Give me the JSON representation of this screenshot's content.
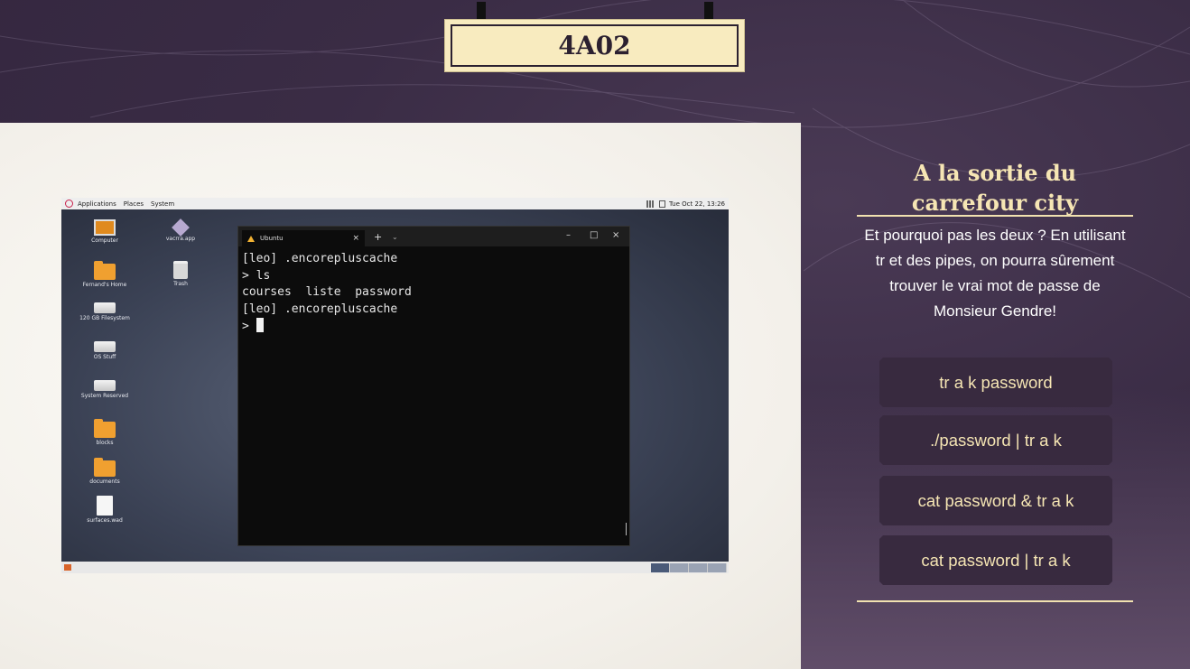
{
  "slide": {
    "title": "4A02",
    "heading": "A la sortie du carrefour city",
    "question": "Et pourquoi pas les deux ? En utilisant tr et des pipes, on pourra sûrement trouver le vrai mot de passe de Monsieur Gendre!",
    "answers": [
      "tr a k password",
      "./password | tr a k",
      "cat password & tr a k",
      "cat password | tr a k"
    ]
  },
  "desktop": {
    "top_bar": {
      "menus": [
        "Applications",
        "Places",
        "System"
      ],
      "clock": "Tue Oct 22, 13:26"
    },
    "icons": [
      {
        "label": "Computer",
        "icon": "computer-icon"
      },
      {
        "label": "vacrra.app",
        "icon": "app-icon"
      },
      {
        "label": "Fernand's Home",
        "icon": "home-folder-icon"
      },
      {
        "label": "Trash",
        "icon": "trash-icon"
      },
      {
        "label": "120 GB Filesystem",
        "icon": "drive-icon"
      },
      {
        "label": "OS Stuff",
        "icon": "drive-icon"
      },
      {
        "label": "System Reserved",
        "icon": "drive-icon"
      },
      {
        "label": "blocks",
        "icon": "locked-folder-icon"
      },
      {
        "label": "documents",
        "icon": "folder-icon"
      },
      {
        "label": "surfaces.wad",
        "icon": "file-icon"
      }
    ],
    "terminal": {
      "tab_title": "Ubuntu",
      "buttons": {
        "close_tab": "×",
        "new_tab": "+",
        "dropdown": "⌄",
        "minimize": "–",
        "maximize": "□",
        "close": "×"
      },
      "lines": [
        "[leo] .encorepluscache",
        "> ls",
        "courses  liste  password",
        "[leo] .encorepluscache",
        "> "
      ]
    }
  },
  "colors": {
    "background": "#3a2c45",
    "accent": "#f6e6b4",
    "answer_bg": "#382a3f"
  }
}
